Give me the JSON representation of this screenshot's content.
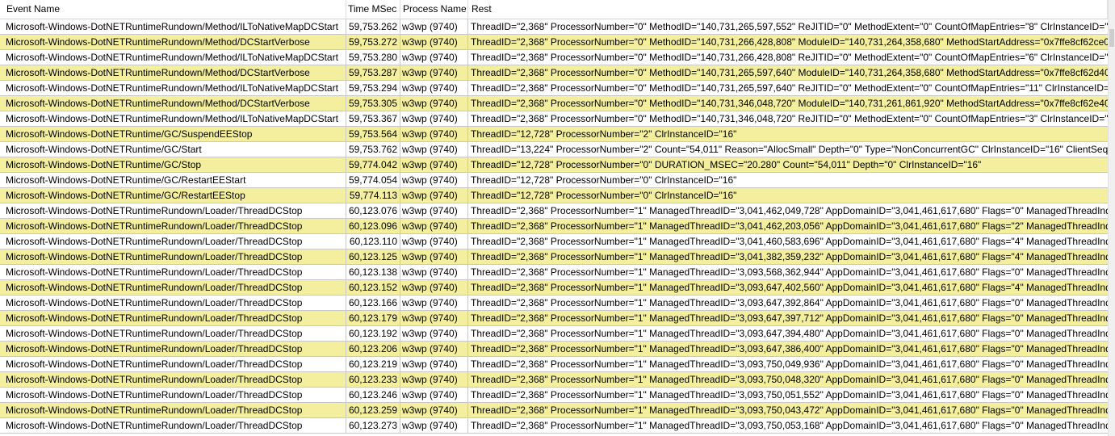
{
  "columns": [
    "Event Name",
    "Time MSec",
    "Process Name",
    "Rest"
  ],
  "rows": [
    {
      "event": "Microsoft-Windows-DotNETRuntimeRundown/Method/ILToNativeMapDCStart",
      "time": "59,753.262",
      "process": "w3wp (9740)",
      "rest": "ThreadID=\"2,368\" ProcessorNumber=\"0\" MethodID=\"140,731,265,597,552\" ReJITID=\"0\" MethodExtent=\"0\" CountOfMapEntries=\"8\" ClrInstanceID=\"1"
    },
    {
      "event": "Microsoft-Windows-DotNETRuntimeRundown/Method/DCStartVerbose",
      "time": "59,753.272",
      "process": "w3wp (9740)",
      "rest": "ThreadID=\"2,368\" ProcessorNumber=\"0\" MethodID=\"140,731,266,428,808\" ModuleID=\"140,731,264,358,680\" MethodStartAddress=\"0x7ffe8cf62ce0\""
    },
    {
      "event": "Microsoft-Windows-DotNETRuntimeRundown/Method/ILToNativeMapDCStart",
      "time": "59,753.280",
      "process": "w3wp (9740)",
      "rest": "ThreadID=\"2,368\" ProcessorNumber=\"0\" MethodID=\"140,731,266,428,808\" ReJITID=\"0\" MethodExtent=\"0\" CountOfMapEntries=\"6\" ClrInstanceID=\"1"
    },
    {
      "event": "Microsoft-Windows-DotNETRuntimeRundown/Method/DCStartVerbose",
      "time": "59,753.287",
      "process": "w3wp (9740)",
      "rest": "ThreadID=\"2,368\" ProcessorNumber=\"0\" MethodID=\"140,731,265,597,640\" ModuleID=\"140,731,264,358,680\" MethodStartAddress=\"0x7ffe8cf62d40\""
    },
    {
      "event": "Microsoft-Windows-DotNETRuntimeRundown/Method/ILToNativeMapDCStart",
      "time": "59,753.294",
      "process": "w3wp (9740)",
      "rest": "ThreadID=\"2,368\" ProcessorNumber=\"0\" MethodID=\"140,731,265,597,640\" ReJITID=\"0\" MethodExtent=\"0\" CountOfMapEntries=\"11\" ClrInstanceID=\""
    },
    {
      "event": "Microsoft-Windows-DotNETRuntimeRundown/Method/DCStartVerbose",
      "time": "59,753.305",
      "process": "w3wp (9740)",
      "rest": "ThreadID=\"2,368\" ProcessorNumber=\"0\" MethodID=\"140,731,346,048,720\" ModuleID=\"140,731,261,861,920\" MethodStartAddress=\"0x7ffe8cf62e40\""
    },
    {
      "event": "Microsoft-Windows-DotNETRuntimeRundown/Method/ILToNativeMapDCStart",
      "time": "59,753.367",
      "process": "w3wp (9740)",
      "rest": "ThreadID=\"2,368\" ProcessorNumber=\"0\" MethodID=\"140,731,346,048,720\" ReJITID=\"0\" MethodExtent=\"0\" CountOfMapEntries=\"3\" ClrInstanceID=\"1"
    },
    {
      "event": "Microsoft-Windows-DotNETRuntime/GC/SuspendEEStop",
      "time": "59,753.564",
      "process": "w3wp (9740)",
      "rest": "ThreadID=\"12,728\" ProcessorNumber=\"2\" ClrInstanceID=\"16\""
    },
    {
      "event": "Microsoft-Windows-DotNETRuntime/GC/Start",
      "time": "59,753.762",
      "process": "w3wp (9740)",
      "rest": "ThreadID=\"13,224\" ProcessorNumber=\"2\" Count=\"54,011\" Reason=\"AllocSmall\" Depth=\"0\" Type=\"NonConcurrentGC\" ClrInstanceID=\"16\" ClientSequ"
    },
    {
      "event": "Microsoft-Windows-DotNETRuntime/GC/Stop",
      "time": "59,774.042",
      "process": "w3wp (9740)",
      "rest": "ThreadID=\"12,728\" ProcessorNumber=\"0\" DURATION_MSEC=\"20.280\" Count=\"54,011\" Depth=\"0\" ClrInstanceID=\"16\""
    },
    {
      "event": "Microsoft-Windows-DotNETRuntime/GC/RestartEEStart",
      "time": "59,774.054",
      "process": "w3wp (9740)",
      "rest": "ThreadID=\"12,728\" ProcessorNumber=\"0\" ClrInstanceID=\"16\""
    },
    {
      "event": "Microsoft-Windows-DotNETRuntime/GC/RestartEEStop",
      "time": "59,774.113",
      "process": "w3wp (9740)",
      "rest": "ThreadID=\"12,728\" ProcessorNumber=\"0\" ClrInstanceID=\"16\""
    },
    {
      "event": "Microsoft-Windows-DotNETRuntimeRundown/Loader/ThreadDCStop",
      "time": "60,123.076",
      "process": "w3wp (9740)",
      "rest": "ThreadID=\"2,368\" ProcessorNumber=\"1\" ManagedThreadID=\"3,041,462,049,728\" AppDomainID=\"3,041,461,617,680\" Flags=\"0\" ManagedThreadIndex"
    },
    {
      "event": "Microsoft-Windows-DotNETRuntimeRundown/Loader/ThreadDCStop",
      "time": "60,123.096",
      "process": "w3wp (9740)",
      "rest": "ThreadID=\"2,368\" ProcessorNumber=\"1\" ManagedThreadID=\"3,041,462,203,056\" AppDomainID=\"3,041,461,617,680\" Flags=\"2\" ManagedThreadIndex"
    },
    {
      "event": "Microsoft-Windows-DotNETRuntimeRundown/Loader/ThreadDCStop",
      "time": "60,123.110",
      "process": "w3wp (9740)",
      "rest": "ThreadID=\"2,368\" ProcessorNumber=\"1\" ManagedThreadID=\"3,041,460,583,696\" AppDomainID=\"3,041,461,617,680\" Flags=\"4\" ManagedThreadIndex"
    },
    {
      "event": "Microsoft-Windows-DotNETRuntimeRundown/Loader/ThreadDCStop",
      "time": "60,123.125",
      "process": "w3wp (9740)",
      "rest": "ThreadID=\"2,368\" ProcessorNumber=\"1\" ManagedThreadID=\"3,041,382,359,232\" AppDomainID=\"3,041,461,617,680\" Flags=\"4\" ManagedThreadIndex"
    },
    {
      "event": "Microsoft-Windows-DotNETRuntimeRundown/Loader/ThreadDCStop",
      "time": "60,123.138",
      "process": "w3wp (9740)",
      "rest": "ThreadID=\"2,368\" ProcessorNumber=\"1\" ManagedThreadID=\"3,093,568,362,944\" AppDomainID=\"3,041,461,617,680\" Flags=\"0\" ManagedThreadIndex"
    },
    {
      "event": "Microsoft-Windows-DotNETRuntimeRundown/Loader/ThreadDCStop",
      "time": "60,123.152",
      "process": "w3wp (9740)",
      "rest": "ThreadID=\"2,368\" ProcessorNumber=\"1\" ManagedThreadID=\"3,093,647,402,560\" AppDomainID=\"3,041,461,617,680\" Flags=\"4\" ManagedThreadIndex"
    },
    {
      "event": "Microsoft-Windows-DotNETRuntimeRundown/Loader/ThreadDCStop",
      "time": "60,123.166",
      "process": "w3wp (9740)",
      "rest": "ThreadID=\"2,368\" ProcessorNumber=\"1\" ManagedThreadID=\"3,093,647,392,864\" AppDomainID=\"3,041,461,617,680\" Flags=\"0\" ManagedThreadIndex"
    },
    {
      "event": "Microsoft-Windows-DotNETRuntimeRundown/Loader/ThreadDCStop",
      "time": "60,123.179",
      "process": "w3wp (9740)",
      "rest": "ThreadID=\"2,368\" ProcessorNumber=\"1\" ManagedThreadID=\"3,093,647,397,712\" AppDomainID=\"3,041,461,617,680\" Flags=\"0\" ManagedThreadIndex"
    },
    {
      "event": "Microsoft-Windows-DotNETRuntimeRundown/Loader/ThreadDCStop",
      "time": "60,123.192",
      "process": "w3wp (9740)",
      "rest": "ThreadID=\"2,368\" ProcessorNumber=\"1\" ManagedThreadID=\"3,093,647,394,480\" AppDomainID=\"3,041,461,617,680\" Flags=\"0\" ManagedThreadIndex"
    },
    {
      "event": "Microsoft-Windows-DotNETRuntimeRundown/Loader/ThreadDCStop",
      "time": "60,123.206",
      "process": "w3wp (9740)",
      "rest": "ThreadID=\"2,368\" ProcessorNumber=\"1\" ManagedThreadID=\"3,093,647,386,400\" AppDomainID=\"3,041,461,617,680\" Flags=\"0\" ManagedThreadIndex"
    },
    {
      "event": "Microsoft-Windows-DotNETRuntimeRundown/Loader/ThreadDCStop",
      "time": "60,123.219",
      "process": "w3wp (9740)",
      "rest": "ThreadID=\"2,368\" ProcessorNumber=\"1\" ManagedThreadID=\"3,093,750,049,936\" AppDomainID=\"3,041,461,617,680\" Flags=\"0\" ManagedThreadIndex"
    },
    {
      "event": "Microsoft-Windows-DotNETRuntimeRundown/Loader/ThreadDCStop",
      "time": "60,123.233",
      "process": "w3wp (9740)",
      "rest": "ThreadID=\"2,368\" ProcessorNumber=\"1\" ManagedThreadID=\"3,093,750,048,320\" AppDomainID=\"3,041,461,617,680\" Flags=\"0\" ManagedThreadIndex"
    },
    {
      "event": "Microsoft-Windows-DotNETRuntimeRundown/Loader/ThreadDCStop",
      "time": "60,123.246",
      "process": "w3wp (9740)",
      "rest": "ThreadID=\"2,368\" ProcessorNumber=\"1\" ManagedThreadID=\"3,093,750,051,552\" AppDomainID=\"3,041,461,617,680\" Flags=\"0\" ManagedThreadIndex"
    },
    {
      "event": "Microsoft-Windows-DotNETRuntimeRundown/Loader/ThreadDCStop",
      "time": "60,123.259",
      "process": "w3wp (9740)",
      "rest": "ThreadID=\"2,368\" ProcessorNumber=\"1\" ManagedThreadID=\"3,093,750,043,472\" AppDomainID=\"3,041,461,617,680\" Flags=\"0\" ManagedThreadIndex"
    },
    {
      "event": "Microsoft-Windows-DotNETRuntimeRundown/Loader/ThreadDCStop",
      "time": "60,123.273",
      "process": "w3wp (9740)",
      "rest": "ThreadID=\"2,368\" ProcessorNumber=\"1\" ManagedThreadID=\"3,093,750,053,168\" AppDomainID=\"3,041,461,617,680\" Flags=\"0\" ManagedThreadIndex"
    }
  ],
  "colors": {
    "row_alt": "#f3ef9f",
    "row": "#ffffff",
    "grid_line": "#c8c8c8"
  }
}
